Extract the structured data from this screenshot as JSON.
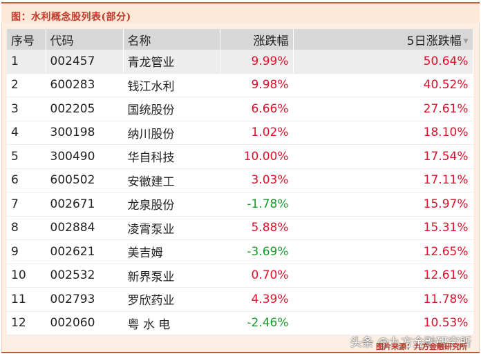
{
  "title": "图：水利概念股列表(部分)",
  "table": {
    "headers": [
      "序号",
      "代码",
      "名称",
      "涨跌幅",
      "5日涨跌幅"
    ],
    "sort_indicator": "▼",
    "rows": [
      {
        "no": "1",
        "code": "002457",
        "name": "青龙管业",
        "chg": "9.99%",
        "chg5": "50.64%",
        "dir": "up",
        "dir5": "up"
      },
      {
        "no": "2",
        "code": "600283",
        "name": "钱江水利",
        "chg": "9.98%",
        "chg5": "40.52%",
        "dir": "up",
        "dir5": "up"
      },
      {
        "no": "3",
        "code": "002205",
        "name": "国统股份",
        "chg": "6.66%",
        "chg5": "27.61%",
        "dir": "up",
        "dir5": "up"
      },
      {
        "no": "4",
        "code": "300198",
        "name": "纳川股份",
        "chg": "1.02%",
        "chg5": "18.10%",
        "dir": "up",
        "dir5": "up"
      },
      {
        "no": "5",
        "code": "300490",
        "name": "华自科技",
        "chg": "10.00%",
        "chg5": "17.54%",
        "dir": "up",
        "dir5": "up"
      },
      {
        "no": "6",
        "code": "600502",
        "name": "安徽建工",
        "chg": "3.03%",
        "chg5": "17.11%",
        "dir": "up",
        "dir5": "up"
      },
      {
        "no": "7",
        "code": "002671",
        "name": "龙泉股份",
        "chg": "-1.78%",
        "chg5": "15.97%",
        "dir": "down",
        "dir5": "up"
      },
      {
        "no": "8",
        "code": "002884",
        "name": "凌霄泵业",
        "chg": "5.88%",
        "chg5": "15.31%",
        "dir": "up",
        "dir5": "up"
      },
      {
        "no": "9",
        "code": "002621",
        "name": "美吉姆",
        "chg": "-3.69%",
        "chg5": "12.65%",
        "dir": "down",
        "dir5": "up"
      },
      {
        "no": "10",
        "code": "002532",
        "name": "新界泵业",
        "chg": "0.70%",
        "chg5": "12.61%",
        "dir": "up",
        "dir5": "up"
      },
      {
        "no": "11",
        "code": "002793",
        "name": "罗欣药业",
        "chg": "4.39%",
        "chg5": "11.78%",
        "dir": "up",
        "dir5": "up"
      },
      {
        "no": "12",
        "code": "002060",
        "name": "粤 水 电",
        "chg": "-2.46%",
        "chg5": "10.53%",
        "dir": "down",
        "dir5": "up"
      }
    ]
  },
  "watermark": "头条 @九方金融研究所",
  "source": "图片来源：九方金融研究所",
  "colors": {
    "up": "#e0102a",
    "down": "#1a9a2a",
    "accent": "#c0392b"
  }
}
